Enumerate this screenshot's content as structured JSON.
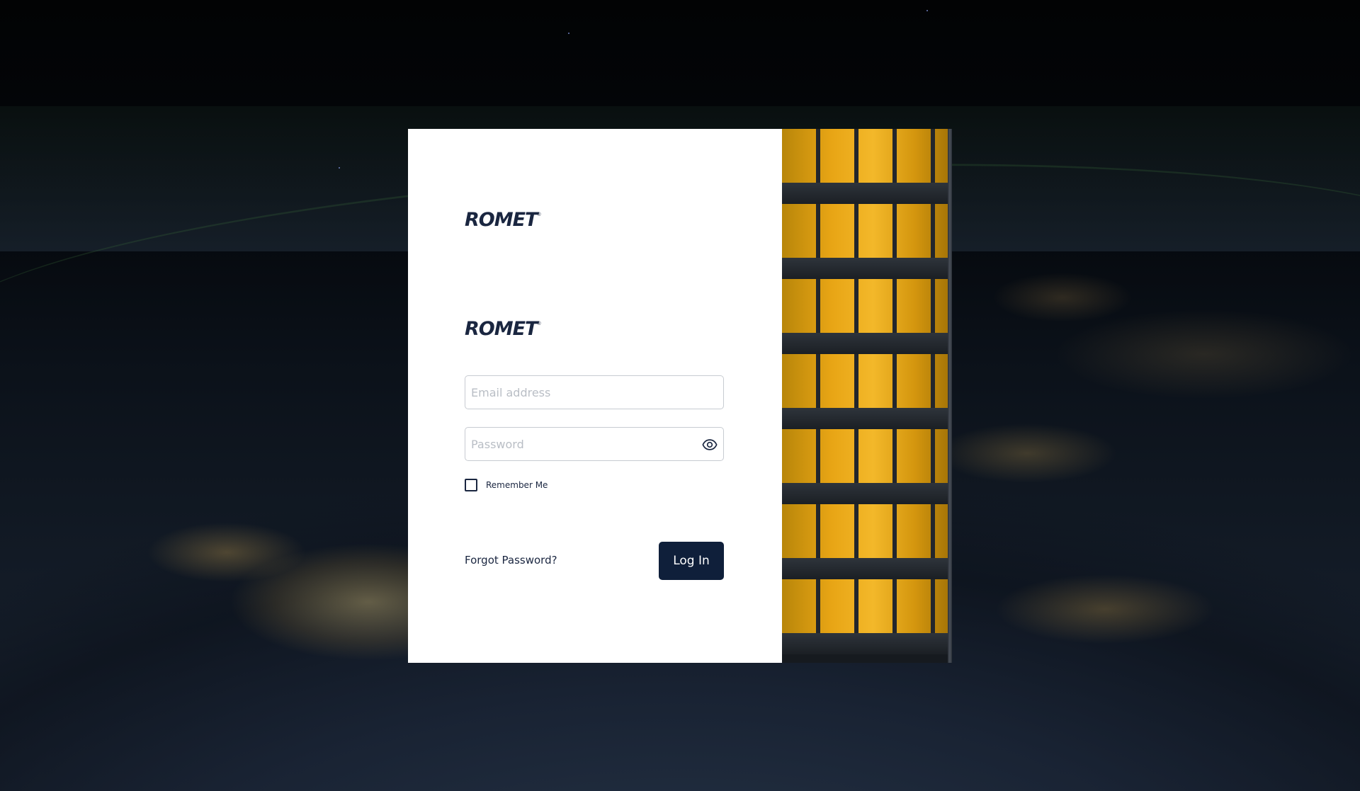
{
  "brand": {
    "logo_text": "ROMET",
    "logo_mark": "®"
  },
  "form": {
    "email_placeholder": "Email address",
    "email_value": "",
    "password_placeholder": "Password",
    "password_value": "",
    "show_password_icon": "eye-icon",
    "remember_label": "Remember Me",
    "remember_checked": false,
    "forgot_label": "Forgot Password?",
    "login_label": "Log In"
  },
  "colors": {
    "brand_navy": "#0f1f3a",
    "logo_navy": "#1a2640",
    "building_light": "#f3b82a"
  }
}
